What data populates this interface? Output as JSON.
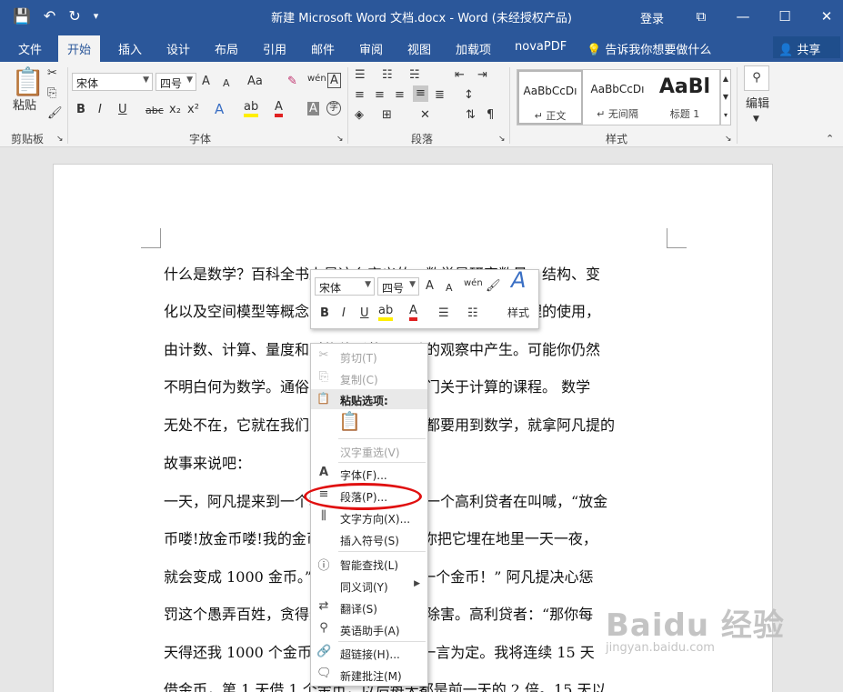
{
  "window": {
    "title": "新建 Microsoft Word 文档.docx - Word (未经授权产品)",
    "login_label": "登录",
    "controls": [
      "⧉",
      "—",
      "☐",
      "✕"
    ]
  },
  "qat": {
    "save_icon": "💾",
    "undo_icon": "↶",
    "redo_icon": "↻",
    "customize_icon": "▾"
  },
  "tabs": [
    {
      "label": "文件"
    },
    {
      "label": "开始",
      "active": true
    },
    {
      "label": "插入"
    },
    {
      "label": "设计"
    },
    {
      "label": "布局"
    },
    {
      "label": "引用"
    },
    {
      "label": "邮件"
    },
    {
      "label": "审阅"
    },
    {
      "label": "视图"
    },
    {
      "label": "加载项"
    },
    {
      "label": "novaPDF"
    }
  ],
  "tellme": "告诉我你想要做什么",
  "share": "共享",
  "ribbon": {
    "clipboard": {
      "paste": "粘贴",
      "label": "剪贴板"
    },
    "font": {
      "font_name": "宋体",
      "font_size": "四号",
      "label": "字体",
      "grow": "A",
      "shrink": "A",
      "case": "Aa",
      "phonetic": "wén",
      "border_char": "A",
      "bold": "B",
      "italic": "I",
      "underline": "U",
      "strike": "abc",
      "sub": "x₂",
      "sup": "x²",
      "effect": "A",
      "highlight": "ab",
      "font_color": "A",
      "shade": "A",
      "circle": "字"
    },
    "paragraph": {
      "label": "段落"
    },
    "styles": {
      "label": "样式",
      "items": [
        {
          "sample": "AaBbCcDı",
          "name": "↵ 正文"
        },
        {
          "sample": "AaBbCcDı",
          "name": "↵ 无间隔"
        },
        {
          "sample": "AaBl",
          "name": "标题 1"
        }
      ]
    },
    "editing": {
      "label": "编辑"
    }
  },
  "document": {
    "lines": [
      "什么是数学？百科全书上是这么定义的：数学是研究数量、结构、变",
      "化以及空间模型等概念的一门学科。透过抽象化和逻辑推理的使用，",
      "由计数、计算、量度和对物体形状及运动的观察中产生。可能你仍然",
      "不明白何为数学。通俗的说，数学就是一门关于计算的课程。   数学",
      "无处不在，它就在我们身边，我们时时候都要用到数学，就拿阿凡提的",
      "故事来说吧：",
      "一天，阿凡提来到一个地方，在那里遇见一个高利贷者在叫喊，“放金",
      "币喽!放金币喽!我的金币会生金币，只要你把它埋在地里一天一夜，",
      "就会变成 1000 金币。”阿凡提说：“我借一个金币！” 阿凡提决心惩",
      "罚这个愚弄百姓，贪得无厌的家伙，为民除害。高利贷者：“那你每",
      "天得还我 1000 个金币。”阿凡提：“好，一言为定。我将连续 15 天",
      "借金币，第 1 天借 1 个金币，以后每天都是前一天的 2 倍。15 天以"
    ]
  },
  "mini_toolbar": {
    "font_name": "宋体",
    "font_size": "四号",
    "grow": "A",
    "shrink": "A",
    "phonetic": "wén",
    "bold": "B",
    "italic": "I",
    "underline": "U",
    "highlight": "ab",
    "font_color": "A",
    "styles_label": "样式",
    "styles_icon": "A"
  },
  "context_menu": {
    "paste_header": "粘贴选项:",
    "items": [
      {
        "label": "剪切(T)",
        "icon": "✂",
        "disabled": true
      },
      {
        "label": "复制(C)",
        "icon": "⎘",
        "disabled": true
      },
      {
        "label": "汉字重选(V)",
        "icon": "",
        "disabled": true
      },
      {
        "label": "字体(F)...",
        "icon": "A"
      },
      {
        "label": "段落(P)...",
        "icon": "≡"
      },
      {
        "label": "文字方向(X)...",
        "icon": "⫼"
      },
      {
        "label": "插入符号(S)",
        "icon": ""
      },
      {
        "label": "智能查找(L)",
        "icon": "ⓘ"
      },
      {
        "label": "同义词(Y)",
        "icon": "",
        "submenu": true
      },
      {
        "label": "翻译(S)",
        "icon": "⇄"
      },
      {
        "label": "英语助手(A)",
        "icon": "⚲"
      },
      {
        "label": "超链接(H)...",
        "icon": "🔗"
      },
      {
        "label": "新建批注(M)",
        "icon": "🗨"
      }
    ]
  },
  "watermark": {
    "logo": "Baidu 经验",
    "url": "jingyan.baidu.com"
  }
}
